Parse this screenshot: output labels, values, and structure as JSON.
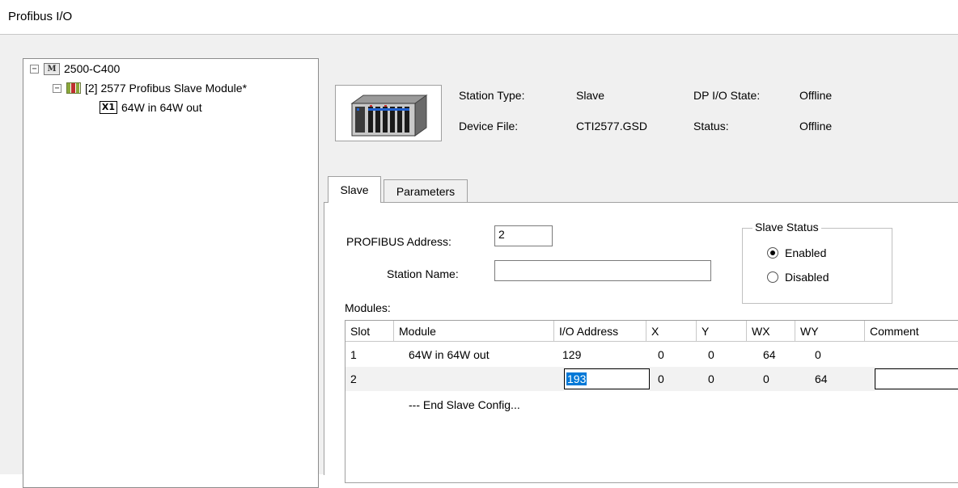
{
  "window": {
    "title": "Profibus I/O"
  },
  "tree": {
    "root": {
      "expander": "−",
      "icon_text": "M",
      "label": "2500-C400"
    },
    "slave": {
      "expander": "−",
      "label": "[2] 2577 Profibus Slave Module*"
    },
    "module": {
      "icon_text": "X1",
      "label": "64W in 64W out"
    }
  },
  "station": {
    "station_type_label": "Station Type:",
    "station_type_value": "Slave",
    "device_file_label": "Device File:",
    "device_file_value": "CTI2577.GSD",
    "dp_state_label": "DP I/O State:",
    "dp_state_value": "Offline",
    "status_label": "Status:",
    "status_value": "Offline"
  },
  "tabs": [
    {
      "label": "Slave",
      "active": true
    },
    {
      "label": "Parameters",
      "active": false
    }
  ],
  "slave_tab": {
    "address_label": "PROFIBUS Address:",
    "address_value": "2",
    "station_name_label": "Station Name:",
    "station_name_value": "",
    "slave_status": {
      "title": "Slave Status",
      "enabled_label": "Enabled",
      "disabled_label": "Disabled",
      "selected": "Enabled"
    },
    "modules_label": "Modules:",
    "columns": [
      "Slot",
      "Module",
      "I/O Address",
      "X",
      "Y",
      "WX",
      "WY",
      "Comment"
    ],
    "rows": [
      {
        "slot": "1",
        "module": "64W in 64W out",
        "io_address": "129",
        "x": "0",
        "y": "0",
        "wx": "64",
        "wy": "0",
        "comment": ""
      },
      {
        "slot": "2",
        "module": "",
        "io_address": "193",
        "x": "0",
        "y": "0",
        "wx": "0",
        "wy": "64",
        "comment": ""
      }
    ],
    "end_text": "--- End Slave Config..."
  },
  "colors": {
    "selection": "#0078d7",
    "row_alt": "#f2f2f2"
  }
}
